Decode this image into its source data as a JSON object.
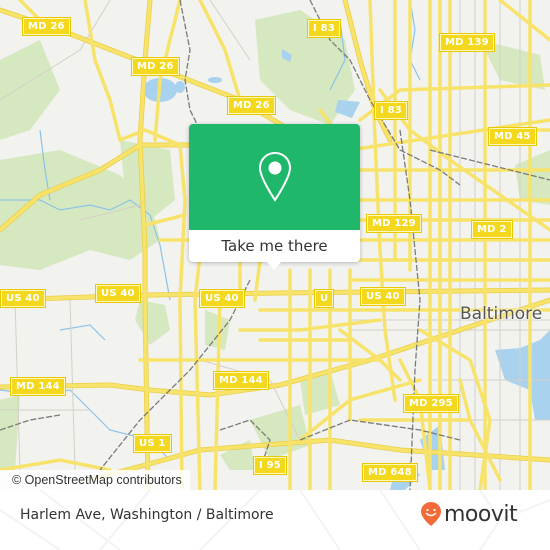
{
  "map": {
    "city_label": "Baltimore",
    "attribution": "© OpenStreetMap contributors",
    "colors": {
      "land": "#f2f2ef",
      "park": "#d6e8bf",
      "water": "#a8d2ee",
      "road": "#f8e36a",
      "road_outline": "#e8cf4a",
      "minor_road": "#d9d6d0",
      "rail": "#777777",
      "shield": "#f3d81e"
    },
    "road_shields": [
      {
        "label": "MD 26",
        "id": "md26-a"
      },
      {
        "label": "MD 26",
        "id": "md26-b"
      },
      {
        "label": "MD 26",
        "id": "md26-c"
      },
      {
        "label": "I 83",
        "id": "i83-a"
      },
      {
        "label": "MD 139",
        "id": "md139"
      },
      {
        "label": "I 83",
        "id": "i83-b"
      },
      {
        "label": "MD 45",
        "id": "md45"
      },
      {
        "label": "MD 129",
        "id": "md129"
      },
      {
        "label": "MD 2",
        "id": "md2"
      },
      {
        "label": "US 40",
        "id": "us40-a"
      },
      {
        "label": "US 40",
        "id": "us40-b"
      },
      {
        "label": "US 40",
        "id": "us40-c"
      },
      {
        "label": "U",
        "id": "us40-d"
      },
      {
        "label": "US 40",
        "id": "us40-e"
      },
      {
        "label": "MD 144",
        "id": "md144-a"
      },
      {
        "label": "MD 144",
        "id": "md144-b"
      },
      {
        "label": "MD 295",
        "id": "md295"
      },
      {
        "label": "US 1",
        "id": "us1"
      },
      {
        "label": "I 95",
        "id": "i95"
      },
      {
        "label": "MD 648",
        "id": "md648"
      }
    ]
  },
  "popup": {
    "button_label": "Take me there",
    "icon": "map-pin-icon",
    "color": "#1fb86a"
  },
  "footer": {
    "title": "Harlem Ave, Washington / Baltimore",
    "brand": "moovit",
    "brand_color": "#f26b38"
  }
}
